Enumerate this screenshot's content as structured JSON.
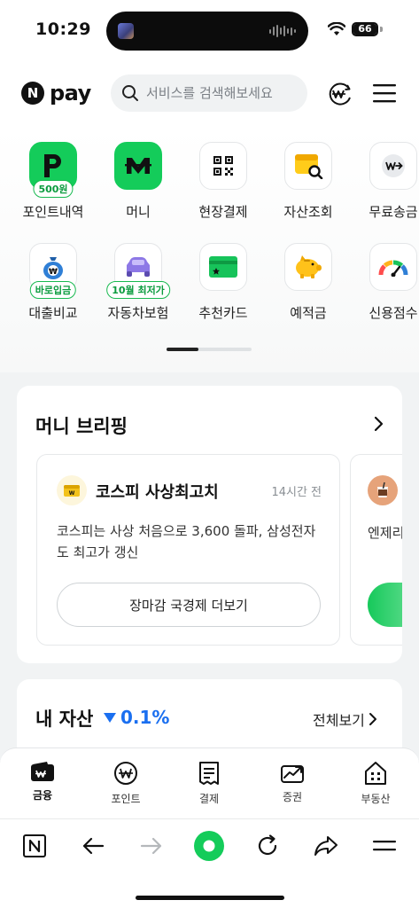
{
  "status_bar": {
    "time": "10:29",
    "battery": "66"
  },
  "header": {
    "logo_text": "pay",
    "logo_mark": "N",
    "search_placeholder": "서비스를 검색해보세요"
  },
  "services": {
    "row1": [
      {
        "label": "포인트내역",
        "icon": "point-p-icon",
        "badge": "500원"
      },
      {
        "label": "머니",
        "icon": "money-m-icon",
        "badge": ""
      },
      {
        "label": "현장결제",
        "icon": "qr-code-icon",
        "badge": ""
      },
      {
        "label": "자산조회",
        "icon": "wallet-search-icon",
        "badge": ""
      },
      {
        "label": "무료송금",
        "icon": "transfer-icon",
        "badge": ""
      }
    ],
    "row2": [
      {
        "label": "대출비교",
        "icon": "money-bag-icon",
        "badge": "바로입금"
      },
      {
        "label": "자동차보험",
        "icon": "car-icon",
        "badge": "10월 최저가"
      },
      {
        "label": "추천카드",
        "icon": "card-icon",
        "badge": ""
      },
      {
        "label": "예적금",
        "icon": "piggy-bank-icon",
        "badge": ""
      },
      {
        "label": "신용점수",
        "icon": "gauge-icon",
        "badge": ""
      }
    ]
  },
  "briefing": {
    "title": "머니 브리핑",
    "card1": {
      "title": "코스피 사상최고치",
      "time": "14시간 전",
      "body": "코스피는 사상 처음으로 3,600 돌파, 삼성전자도 최고가 갱신",
      "button": "장마감 국경제 더보기"
    },
    "card2": {
      "text": "엔제리"
    }
  },
  "assets": {
    "title": "내 자산",
    "change": "0.1%",
    "view_all": "전체보기"
  },
  "tabbar": [
    {
      "label": "금융",
      "active": true
    },
    {
      "label": "포인트",
      "active": false
    },
    {
      "label": "결제",
      "active": false
    },
    {
      "label": "증권",
      "active": false
    },
    {
      "label": "부동산",
      "active": false
    }
  ],
  "browser": {
    "n_label": "N"
  },
  "colors": {
    "brand_green": "#14cc5a",
    "down_blue": "#1a6ff0"
  }
}
